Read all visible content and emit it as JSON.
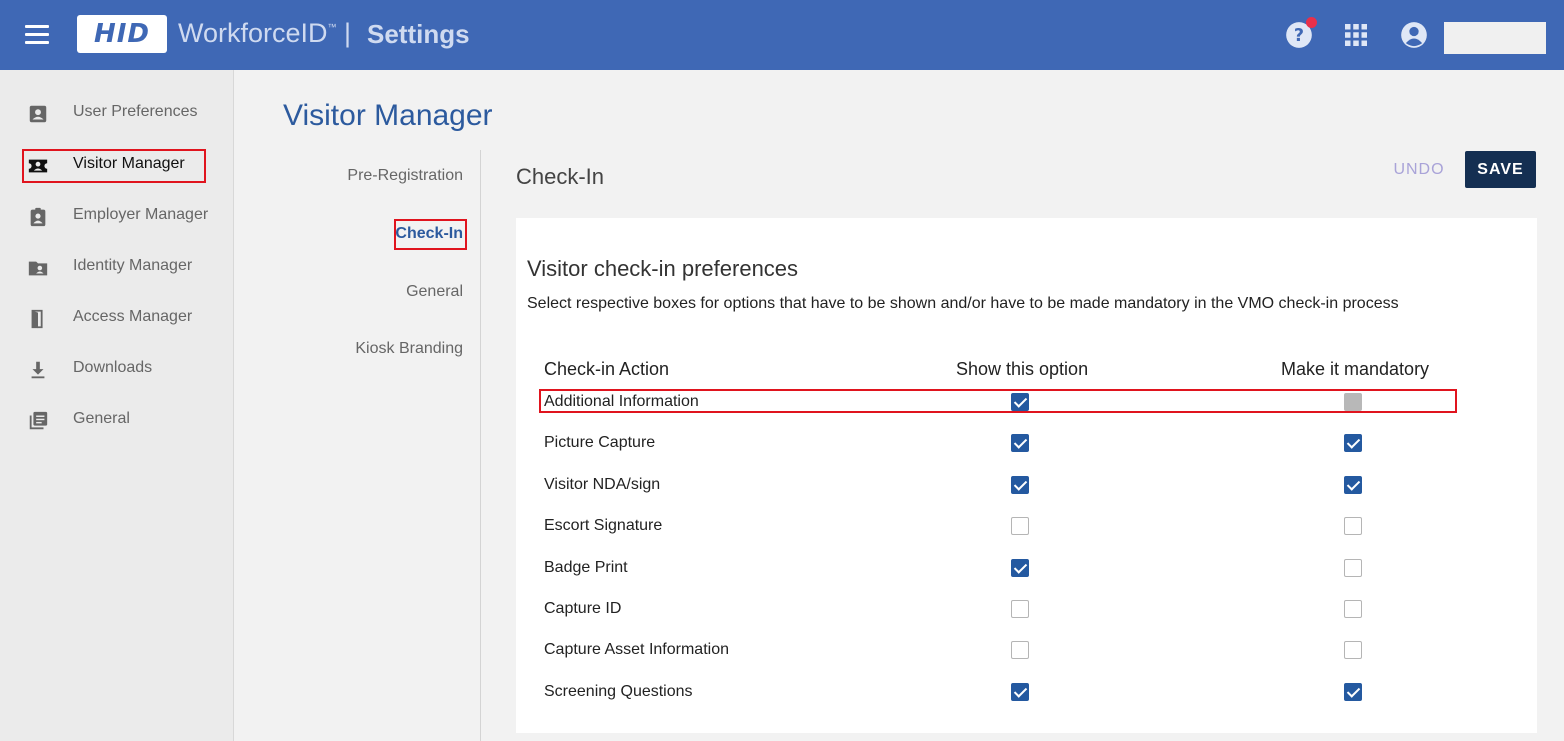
{
  "header": {
    "logo": "HID",
    "product": "WorkforceID",
    "trademark": "™",
    "separator": "|",
    "section": "Settings"
  },
  "sidebar": {
    "items": [
      {
        "label": "User Preferences",
        "icon": "account-box-icon",
        "active": false
      },
      {
        "label": "Visitor Manager",
        "icon": "visitor-badge-icon",
        "active": true
      },
      {
        "label": "Employer Manager",
        "icon": "clipboard-user-icon",
        "active": false
      },
      {
        "label": "Identity Manager",
        "icon": "folder-user-icon",
        "active": false
      },
      {
        "label": "Access Manager",
        "icon": "door-icon",
        "active": false
      },
      {
        "label": "Downloads",
        "icon": "download-icon",
        "active": false
      },
      {
        "label": "General",
        "icon": "library-icon",
        "active": false
      }
    ]
  },
  "page": {
    "title": "Visitor Manager"
  },
  "subnav": {
    "items": [
      {
        "label": "Pre-Registration",
        "active": false
      },
      {
        "label": "Check-In",
        "active": true
      },
      {
        "label": "General",
        "active": false
      },
      {
        "label": "Kiosk Branding",
        "active": false
      }
    ]
  },
  "content": {
    "title": "Check-In",
    "undo_label": "UNDO",
    "save_label": "SAVE"
  },
  "card": {
    "title": "Visitor check-in preferences",
    "description": "Select respective boxes for options that have to be shown and/or have to be made mandatory in the VMO check-in process",
    "columns": [
      "Check-in Action",
      "Show this option",
      "Make it mandatory"
    ],
    "rows": [
      {
        "action": "Additional Information",
        "show": "checked",
        "mandatory": "disabled"
      },
      {
        "action": "Picture Capture",
        "show": "checked",
        "mandatory": "checked"
      },
      {
        "action": "Visitor NDA/sign",
        "show": "checked",
        "mandatory": "checked"
      },
      {
        "action": "Escort Signature",
        "show": "unchecked",
        "mandatory": "unchecked"
      },
      {
        "action": "Badge Print",
        "show": "checked",
        "mandatory": "unchecked"
      },
      {
        "action": "Capture ID",
        "show": "unchecked",
        "mandatory": "unchecked"
      },
      {
        "action": "Capture Asset Information",
        "show": "unchecked",
        "mandatory": "unchecked"
      },
      {
        "action": "Screening Questions",
        "show": "checked",
        "mandatory": "checked"
      }
    ]
  },
  "colors": {
    "header_bg": "#3f68b5",
    "accent": "#2c5a9e",
    "checkbox": "#2459a0",
    "save_bg": "#142f52",
    "highlight": "#e0141e",
    "notification": "#e8304a"
  }
}
